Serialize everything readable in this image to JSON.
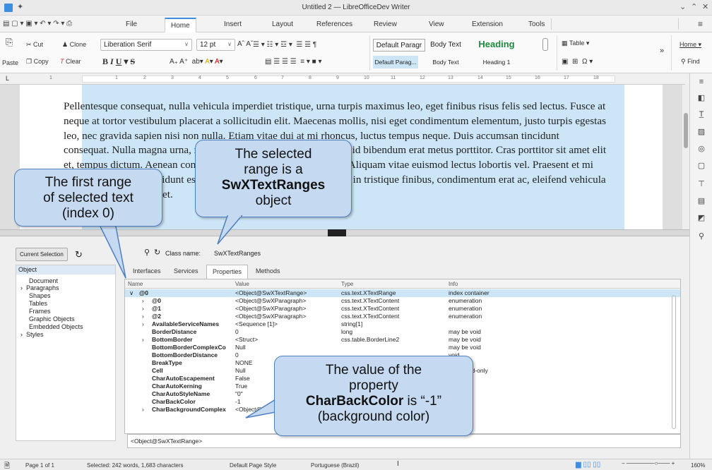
{
  "window": {
    "title": "Untitled 2 — LibreOfficeDev Writer"
  },
  "menu_tabs": [
    "File",
    "Home",
    "Insert",
    "Layout",
    "References",
    "Review",
    "View",
    "Extension",
    "Tools"
  ],
  "active_tab": "Home",
  "ribbon": {
    "paste": "Paste",
    "cut": "Cut",
    "copy": "Copy",
    "clone": "Clone",
    "clear": "Clear",
    "font_name": "Liberation Serif",
    "font_size": "12 pt",
    "style_default_paragraph": "Default Paragr",
    "style_body_text": "Body Text",
    "style_heading": "Heading",
    "style_default_paragraph_small": "Default Parag...",
    "style_body_text_small": "Body Text",
    "style_heading1": "Heading 1",
    "table": "Table",
    "omega": "Ω",
    "home_dropdown": "Home",
    "find": "Find"
  },
  "ruler": {
    "numbers": [
      "1",
      "1",
      "2",
      "3",
      "4",
      "5",
      "6",
      "7",
      "8",
      "9",
      "10",
      "11",
      "12",
      "13",
      "14",
      "15",
      "16",
      "17",
      "18"
    ]
  },
  "document": {
    "text": "Pellentesque consequat, nulla vehicula imperdiet tristique, urna turpis maximus leo, eget finibus risus felis sed lectus. Fusce at neque at tortor vestibulum placerat a sollicitudin elit. Maecenas mollis, nisi eget condimentum elementum, justo turpis egestas leo, nec gravida sapien nisi non nulla. Etiam vitae dui at mi rhoncus, luctus tempus neque. Duis accumsan tincidunt consequat. Nulla magna urna, rhoncus ac erat justo eleifend turpis, id bibendum erat metus porttitor. Cras porttitor sit amet elit et, tempus dictum. Aenean consequat gravida suscipit. Cras lacus. Aliquam vitae euismod lectus lobortis vel. Praesent et mi nisl elementum, ut tincidunt est et, sollicitudin molestie nisl. Fusce in tristique finibus, condimentum erat ac, eleifend vehicula tellus consectetur aliquet."
  },
  "inspector": {
    "current_selection": "Current Selection",
    "class_name_label": "Class name:",
    "class_name_value": "SwXTextRanges",
    "nav_header": "Object",
    "nav_items": [
      "Document",
      "Paragraphs",
      "Shapes",
      "Tables",
      "Frames",
      "Graphic Objects",
      "Embedded Objects",
      "Styles"
    ],
    "tabs": [
      "Interfaces",
      "Services",
      "Properties",
      "Methods"
    ],
    "active_tab": "Properties",
    "columns": [
      "Name",
      "Value",
      "Type",
      "Info"
    ],
    "rows": [
      {
        "name": "@0",
        "value": "<Object@SwXTextRange>",
        "type": "css.text.XTextRange",
        "info": "index container"
      },
      {
        "name": "@0",
        "value": "<Object@SwXParagraph>",
        "type": "css.text.XTextContent",
        "info": "enumeration"
      },
      {
        "name": "@1",
        "value": "<Object@SwXParagraph>",
        "type": "css.text.XTextContent",
        "info": "enumeration"
      },
      {
        "name": "@2",
        "value": "<Object@SwXParagraph>",
        "type": "css.text.XTextContent",
        "info": "enumeration"
      },
      {
        "name": "AvailableServiceNames",
        "value": "<Sequence [1]>",
        "type": "string[1]",
        "info": ""
      },
      {
        "name": "BorderDistance",
        "value": "0",
        "type": "long",
        "info": "may be void"
      },
      {
        "name": "BottomBorder",
        "value": "<Struct>",
        "type": "css.table.BorderLine2",
        "info": "may be void"
      },
      {
        "name": "BottomBorderComplexCo",
        "value": "Null",
        "type": "",
        "info": "may be void"
      },
      {
        "name": "BottomBorderDistance",
        "value": "0",
        "type": "",
        "info": "void"
      },
      {
        "name": "BreakType",
        "value": "NONE",
        "type": "",
        "info": "void"
      },
      {
        "name": "Cell",
        "value": "Null",
        "type": "",
        "info": "void, read-only"
      },
      {
        "name": "CharAutoEscapement",
        "value": "False",
        "type": "",
        "info": "void"
      },
      {
        "name": "CharAutoKerning",
        "value": "True",
        "type": "",
        "info": "void"
      },
      {
        "name": "CharAutoStyleName",
        "value": "\"0\"",
        "type": "",
        "info": "void"
      },
      {
        "name": "CharBackColor",
        "value": "-1",
        "type": "",
        "info": "void"
      },
      {
        "name": "CharBackgroundComplex",
        "value": "<Object@...",
        "type": "",
        "info": ""
      }
    ],
    "value_box": "<Object@SwXTextRange>"
  },
  "status": {
    "page": "Page 1 of 1",
    "selected": "Selected: 242 words, 1,683 characters",
    "page_style": "Default Page Style",
    "language": "Portuguese (Brazil)",
    "zoom": "160%"
  },
  "callouts": {
    "c1": [
      "The selected",
      "range is a"
    ],
    "c1_bold": "SwXTextRanges",
    "c1_end": "object",
    "c2": [
      "The first range",
      "of selected text",
      "(index 0)"
    ],
    "c3": [
      "The value of the",
      "property"
    ],
    "c3_bold": "CharBackColor",
    "c3_after": " is “-1”",
    "c3_end": "(background color)"
  }
}
